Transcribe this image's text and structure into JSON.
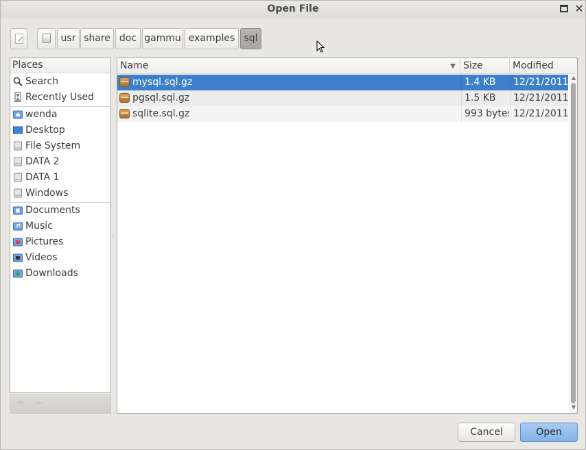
{
  "window": {
    "title": "Open File"
  },
  "pathbar": {
    "segments": [
      "usr",
      "share",
      "doc",
      "gammu",
      "examples",
      "sql"
    ],
    "active_segment": "sql"
  },
  "places": {
    "header": "Places",
    "items": [
      {
        "label": "Search",
        "icon": "search-icon"
      },
      {
        "label": "Recently Used",
        "icon": "recent-icon"
      },
      {
        "label": "wenda",
        "icon": "home-folder-icon"
      },
      {
        "label": "Desktop",
        "icon": "desktop-icon"
      },
      {
        "label": "File System",
        "icon": "drive-icon"
      },
      {
        "label": "DATA 2",
        "icon": "drive-icon"
      },
      {
        "label": "DATA 1",
        "icon": "drive-icon"
      },
      {
        "label": "Windows",
        "icon": "drive-icon"
      },
      {
        "label": "Documents",
        "icon": "documents-folder-icon"
      },
      {
        "label": "Music",
        "icon": "music-folder-icon"
      },
      {
        "label": "Pictures",
        "icon": "pictures-folder-icon"
      },
      {
        "label": "Videos",
        "icon": "videos-folder-icon"
      },
      {
        "label": "Downloads",
        "icon": "downloads-folder-icon"
      }
    ],
    "footer": {
      "add": "+",
      "remove": "−"
    }
  },
  "files": {
    "columns": {
      "name": "Name",
      "size": "Size",
      "modified": "Modified"
    },
    "rows": [
      {
        "name": "mysql.sql.gz",
        "size": "1.4 KB",
        "modified": "12/21/2011",
        "selected": true
      },
      {
        "name": "pgsql.sql.gz",
        "size": "1.5 KB",
        "modified": "12/21/2011",
        "selected": false
      },
      {
        "name": "sqlite.sql.gz",
        "size": "993 bytes",
        "modified": "12/21/2011",
        "selected": false
      }
    ]
  },
  "buttons": {
    "cancel": "Cancel",
    "open": "Open"
  },
  "colors": {
    "selection": "#3d80c9",
    "primary_button": "#86b3e8"
  }
}
